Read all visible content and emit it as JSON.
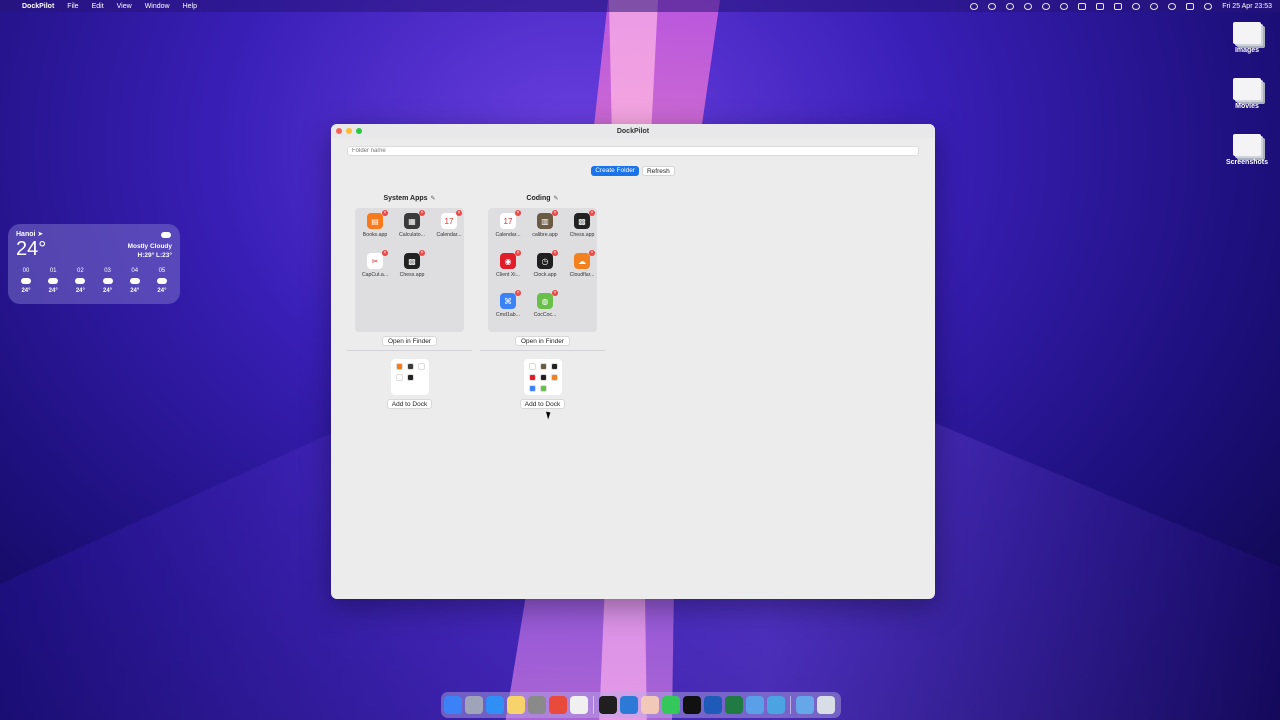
{
  "menubar": {
    "app_name": "DockPilot",
    "items": [
      "File",
      "Edit",
      "View",
      "Window",
      "Help"
    ],
    "clock": "Fri 25 Apr  23:53"
  },
  "desktop": {
    "icons": [
      {
        "label": "Images"
      },
      {
        "label": "Movies"
      },
      {
        "label": "Screenshots"
      }
    ]
  },
  "weather": {
    "city": "Hanoi",
    "temperature": "24°",
    "condition": "Mostly Cloudy",
    "high_low": "H:29° L:23°",
    "hours": [
      {
        "hour": "00",
        "temp": "24°"
      },
      {
        "hour": "01",
        "temp": "24°"
      },
      {
        "hour": "02",
        "temp": "24°"
      },
      {
        "hour": "03",
        "temp": "24°"
      },
      {
        "hour": "04",
        "temp": "24°"
      },
      {
        "hour": "05",
        "temp": "24°"
      }
    ]
  },
  "window": {
    "title": "DockPilot",
    "folder_input_placeholder": "Folder name",
    "create_label": "Create Folder",
    "refresh_label": "Refresh",
    "open_in_finder_label": "Open in Finder",
    "add_to_dock_label": "Add to Dock",
    "edit_glyph": "✎",
    "remove_glyph": "×",
    "groups": [
      {
        "name": "System Apps",
        "apps": [
          {
            "label": "Books.app",
            "icon": "books-icon",
            "color": "#f97a1c",
            "glyph": "▤"
          },
          {
            "label": "Calculato...",
            "icon": "calculator-icon",
            "color": "#3a3a3a",
            "glyph": "▦"
          },
          {
            "label": "Calendar...",
            "icon": "calendar-icon",
            "color": "#ffffff",
            "glyph": "17"
          },
          {
            "label": "CapCut.a...",
            "icon": "capcut-icon",
            "color": "#ffffff",
            "glyph": "✂"
          },
          {
            "label": "Chess.app",
            "icon": "chess-icon",
            "color": "#222222",
            "glyph": "▩"
          }
        ]
      },
      {
        "name": "Coding",
        "apps": [
          {
            "label": "Calendar...",
            "icon": "calendar-icon",
            "color": "#ffffff",
            "glyph": "17"
          },
          {
            "label": "calibre.app",
            "icon": "calibre-icon",
            "color": "#6b5b45",
            "glyph": "▥"
          },
          {
            "label": "Chess.app",
            "icon": "chess-icon",
            "color": "#222222",
            "glyph": "▩"
          },
          {
            "label": "Client Xi...",
            "icon": "client-icon",
            "color": "#e11d2a",
            "glyph": "◉"
          },
          {
            "label": "Clock.app",
            "icon": "clock-icon",
            "color": "#1f1f1f",
            "glyph": "◷"
          },
          {
            "label": "Cloudflar...",
            "icon": "cloudflare-icon",
            "color": "#f48120",
            "glyph": "☁"
          },
          {
            "label": "Cmd1ab...",
            "icon": "cmd-icon",
            "color": "#3b82f6",
            "glyph": "⌘"
          },
          {
            "label": "CocCoc...",
            "icon": "coccoc-icon",
            "color": "#6abf4b",
            "glyph": "◍"
          }
        ]
      }
    ]
  }
}
